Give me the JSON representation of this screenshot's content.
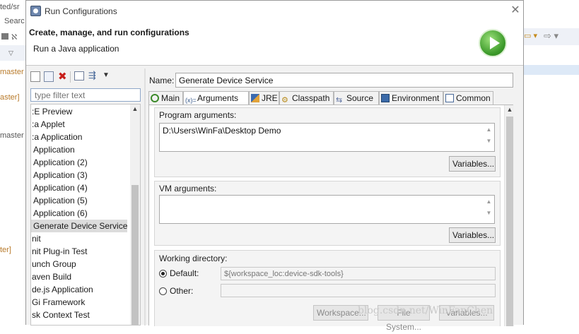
{
  "background": {
    "left_fragments": [
      "ted/sr",
      "Searc",
      "master",
      "aster]",
      "master",
      "ter]"
    ],
    "right_icons": [
      "run-dropdown-icon",
      "forward-arrow-icon"
    ]
  },
  "dialog": {
    "title": "Run Configurations",
    "close_icon": "close-icon",
    "header_title": "Create, manage, and run configurations",
    "header_subtitle": "Run a Java application",
    "run_icon": "run-icon"
  },
  "left": {
    "toolbar_icons": [
      "new-config-icon",
      "duplicate-icon",
      "delete-icon",
      "collapse-all-icon",
      "filter-icon",
      "view-menu-icon"
    ],
    "filter_placeholder": "type filter text",
    "tree": [
      ":E Preview",
      ":a Applet",
      ":a Application",
      "Application",
      "Application (2)",
      "Application (3)",
      "Application (4)",
      "Application (5)",
      "Application (6)",
      "Generate Device Service",
      "nit",
      "nit Plug-in Test",
      "unch Group",
      "aven Build",
      "de.js Application",
      "Gi Framework",
      "sk Context Test"
    ],
    "selected_item": "Generate Device Service"
  },
  "right": {
    "name_label": "Name:",
    "name_value": "Generate Device Service",
    "tabs": [
      {
        "label": "Main",
        "icon": "main-icon"
      },
      {
        "label": "Arguments",
        "icon": "arguments-icon"
      },
      {
        "label": "JRE",
        "icon": "jre-icon"
      },
      {
        "label": "Classpath",
        "icon": "classpath-icon"
      },
      {
        "label": "Source",
        "icon": "source-icon"
      },
      {
        "label": "Environment",
        "icon": "environment-icon"
      },
      {
        "label": "Common",
        "icon": "common-icon"
      }
    ],
    "active_tab": "Arguments",
    "program_args_label": "Program arguments:",
    "program_args_value": "D:\\Users\\WinFa\\Desktop Demo",
    "variables_label": "Variables...",
    "vm_args_label": "VM arguments:",
    "vm_args_value": "",
    "working_dir_label": "Working directory:",
    "default_label": "Default:",
    "default_value": "${workspace_loc:device-sdk-tools}",
    "other_label": "Other:",
    "other_value": "",
    "workspace_label": "Workspace...",
    "filesystem_label": "File System...",
    "variables2_label": "Variables..."
  },
  "watermark": "blog.csdn.net/WinFanChen"
}
